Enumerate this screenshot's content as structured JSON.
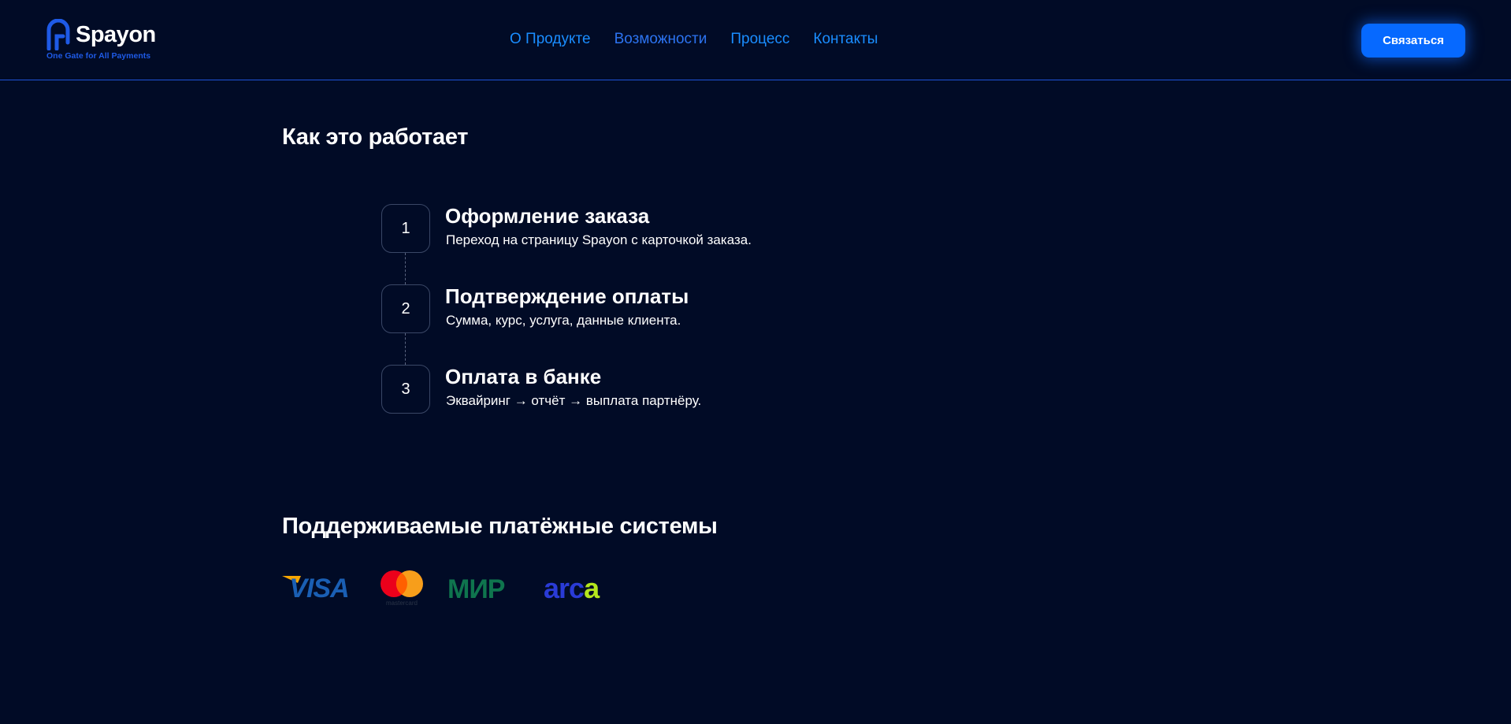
{
  "header": {
    "brand": "Spayon",
    "tagline": "One Gate for All Payments",
    "nav": [
      {
        "label": "О Продукте"
      },
      {
        "label": "Возможности"
      },
      {
        "label": "Процесс"
      },
      {
        "label": "Контакты"
      }
    ],
    "cta_label": "Связаться"
  },
  "how_it_works": {
    "title": "Как это работает",
    "steps": [
      {
        "number": "1",
        "title": "Оформление заказа",
        "description": "Переход на страницу Spayon с карточкой заказа."
      },
      {
        "number": "2",
        "title": "Подтверждение оплаты",
        "description": "Сумма, курс, услуга, данные клиента."
      },
      {
        "number": "3",
        "title": "Оплата в банке",
        "description": "Эквайринг → отчёт → выплата партнёру."
      }
    ]
  },
  "payment_systems": {
    "title": "Поддерживаемые платёжные системы",
    "logos": [
      {
        "name": "visa-logo",
        "text": "VISA"
      },
      {
        "name": "mastercard-logo",
        "text": "mastercard"
      },
      {
        "name": "mir-logo",
        "text": "МИР"
      },
      {
        "name": "arca-logo",
        "text": "arca"
      }
    ]
  },
  "colors": {
    "background": "#010b26",
    "accent": "#0669ff",
    "nav_link": "#1a8dff",
    "header_border": "#1f52d6"
  }
}
